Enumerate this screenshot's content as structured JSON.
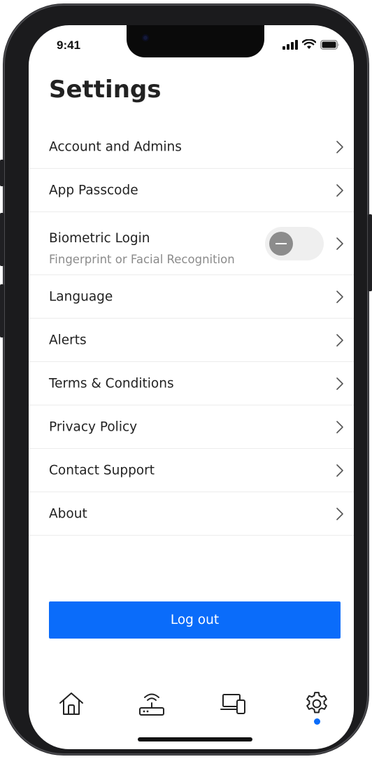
{
  "status_bar": {
    "time": "9:41",
    "icons": [
      "cellular-signal-icon",
      "wifi-icon",
      "battery-icon"
    ]
  },
  "page": {
    "title": "Settings"
  },
  "settings_items": [
    {
      "label": "Account and Admins",
      "icon": "chevron-right-icon"
    },
    {
      "label": "App Passcode",
      "icon": "chevron-right-icon"
    },
    {
      "label": "Biometric Login",
      "sublabel": "Fingerprint or Facial Recognition",
      "toggle": "off",
      "icon": "chevron-right-icon"
    },
    {
      "label": "Language",
      "icon": "chevron-right-icon"
    },
    {
      "label": "Alerts",
      "icon": "chevron-right-icon"
    },
    {
      "label": "Terms & Conditions",
      "icon": "chevron-right-icon"
    },
    {
      "label": "Privacy Policy",
      "icon": "chevron-right-icon"
    },
    {
      "label": "Contact Support",
      "icon": "chevron-right-icon"
    },
    {
      "label": "About",
      "icon": "chevron-right-icon"
    }
  ],
  "logout": {
    "label": "Log out"
  },
  "tab_bar": {
    "tabs": [
      {
        "name": "home",
        "icon": "home-icon"
      },
      {
        "name": "router",
        "icon": "router-icon"
      },
      {
        "name": "devices",
        "icon": "devices-icon"
      },
      {
        "name": "settings",
        "icon": "gear-icon",
        "active": true
      }
    ]
  },
  "colors": {
    "accent": "#0a6cfa",
    "text": "#222222",
    "subtext": "#8b8b8b",
    "divider": "#ececec",
    "toggle_track": "#efefef",
    "toggle_knob": "#8c8c8c"
  }
}
